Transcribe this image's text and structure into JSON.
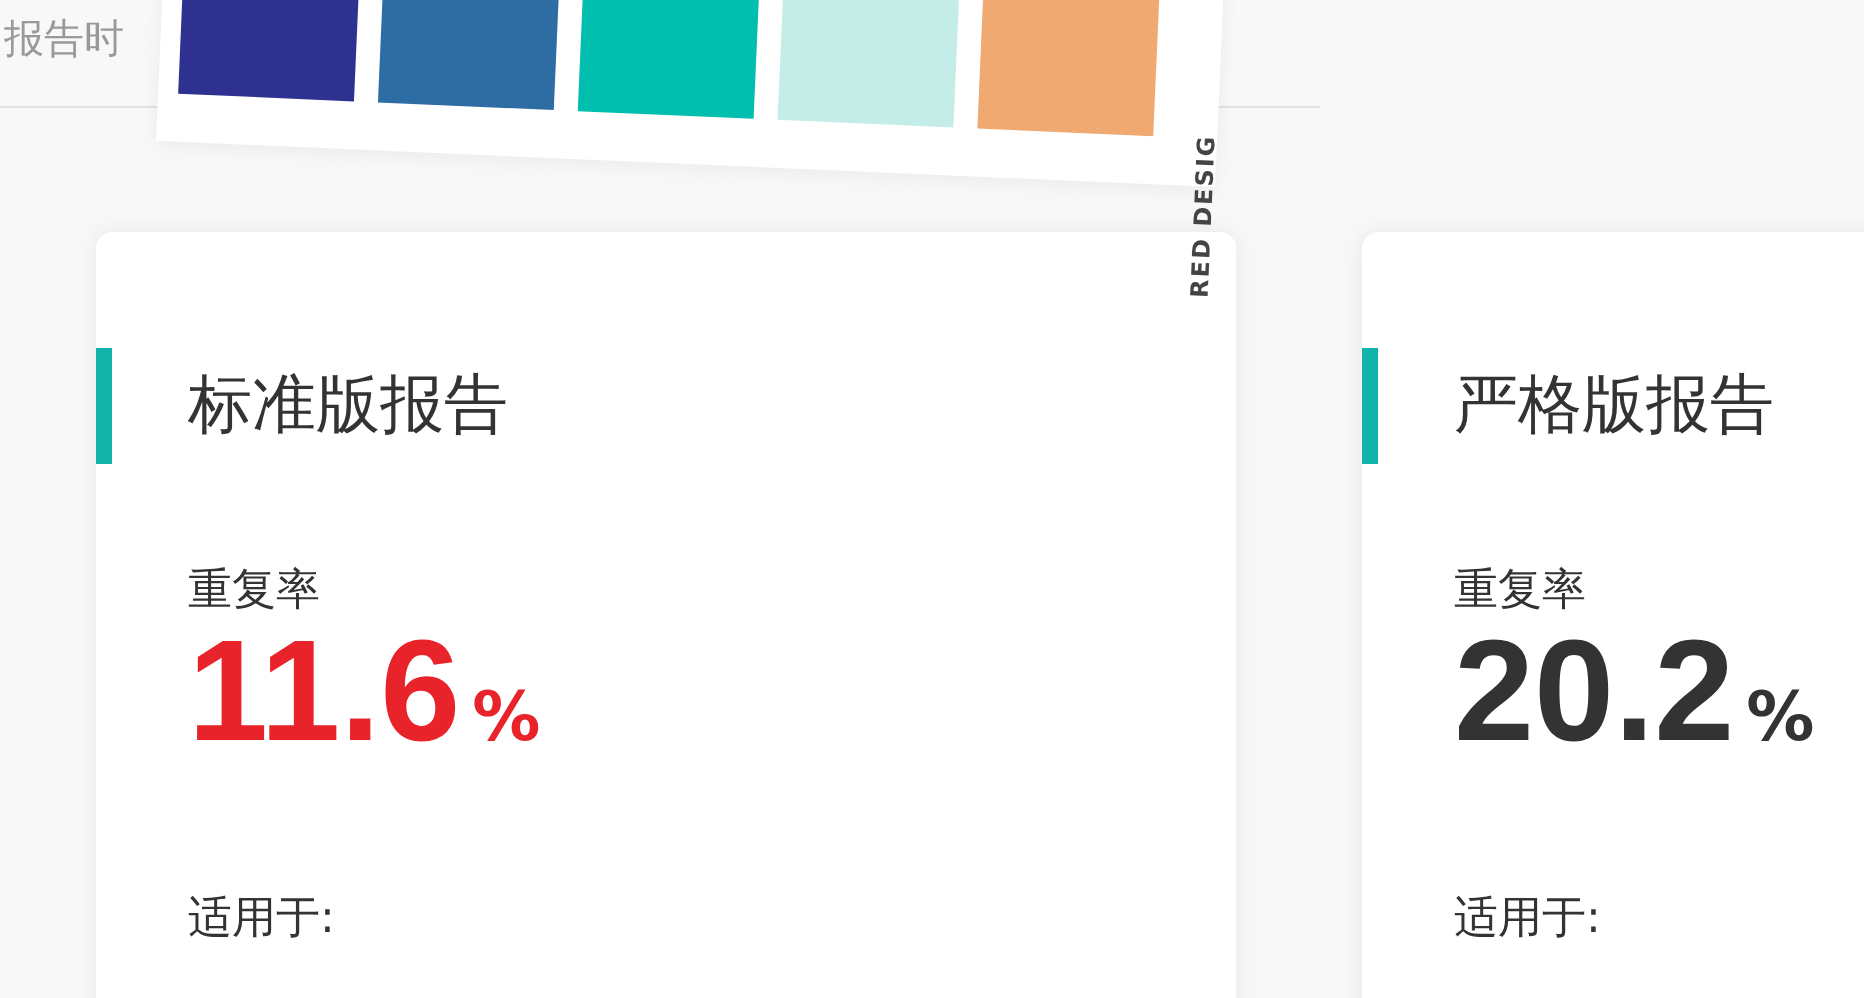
{
  "header": {
    "title": "报告时"
  },
  "palette": {
    "swatches": [
      {
        "color": "#2e3190"
      },
      {
        "color": "#2e6ca4"
      },
      {
        "color": "#00bfae"
      },
      {
        "color": "#c5ede8"
      },
      {
        "color": "#f0a971"
      }
    ],
    "caption": "RED DESIG"
  },
  "cards": [
    {
      "name": "标准版报告",
      "rate_label": "重复率",
      "rate": "11.6",
      "unit": "%",
      "color": "#e8232a",
      "applies_label": "适用于:"
    },
    {
      "name": "严格版报告",
      "rate_label": "重复率",
      "rate": "20.2",
      "unit": "%",
      "color": "#333333",
      "applies_label": "适用于:"
    }
  ]
}
